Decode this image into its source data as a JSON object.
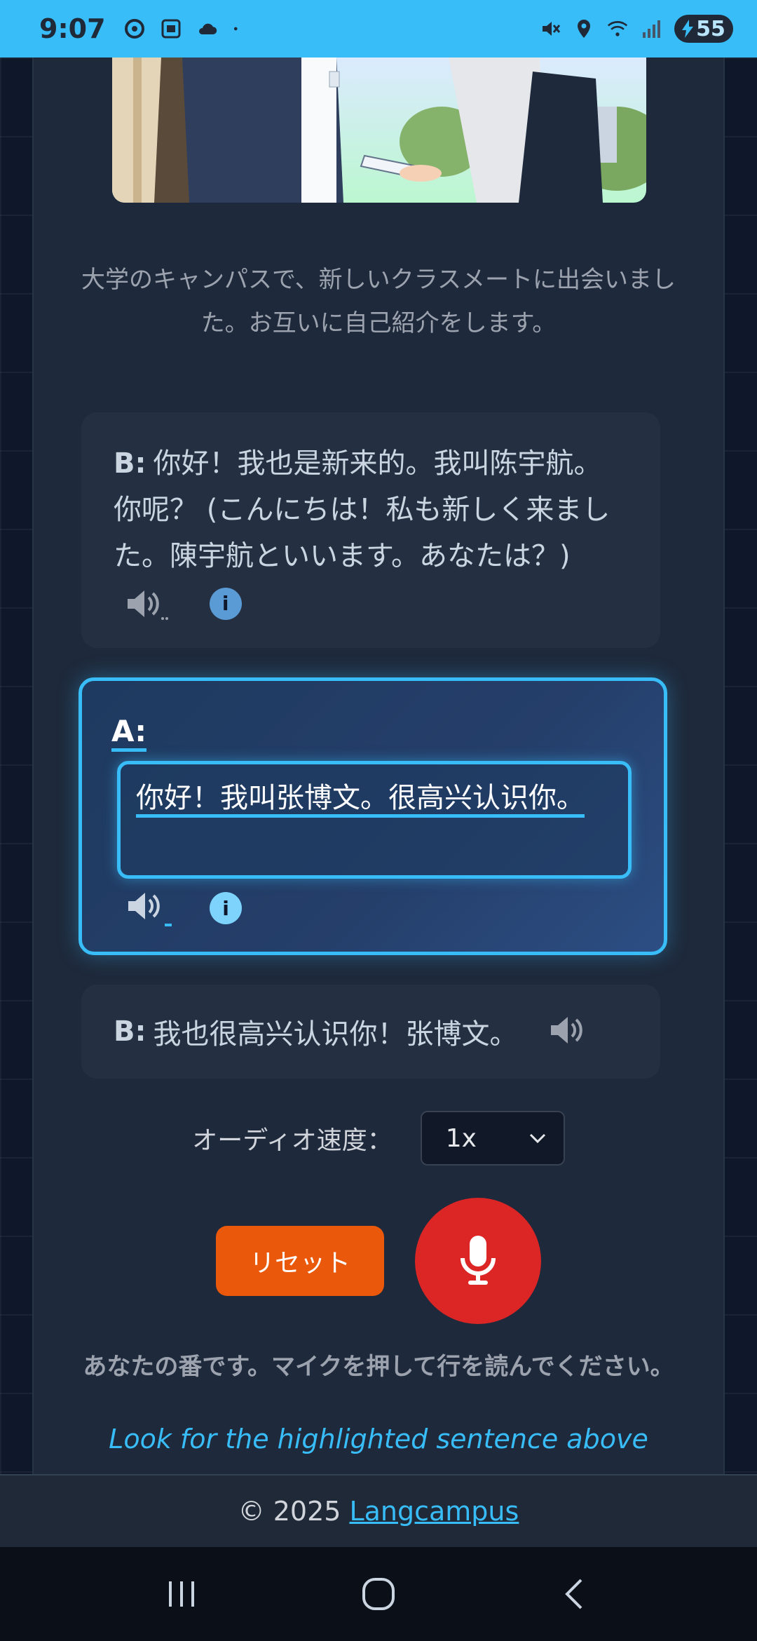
{
  "status_bar": {
    "time": "9:07",
    "battery": "55"
  },
  "intro_text": "大学のキャンパスで、新しいクラスメートに出会いました。お互いに自己紹介をします。",
  "dialogue": [
    {
      "speaker": "B:",
      "text": "你好！我也是新来的。我叫陈宇航。你呢？ (こんにちは！私も新しく来ました。陳宇航といいます。あなたは？)"
    },
    {
      "speaker": "A:",
      "text": "你好！我叫张博文。很高兴认识你。",
      "active": true
    },
    {
      "speaker": "B:",
      "text": "我也很高兴认识你！张博文。"
    }
  ],
  "speed": {
    "label": "オーディオ速度：",
    "value": "1x"
  },
  "buttons": {
    "reset": "リセット"
  },
  "turn_text": "あなたの番です。マイクを押して行を読んでください。",
  "hint_text": "Look for the highlighted sentence above",
  "footer": {
    "copyright": "© 2025",
    "link": "Langcampus"
  },
  "colors": {
    "accent": "#38bdf8",
    "reset": "#ea580c",
    "mic": "#dc2626"
  }
}
